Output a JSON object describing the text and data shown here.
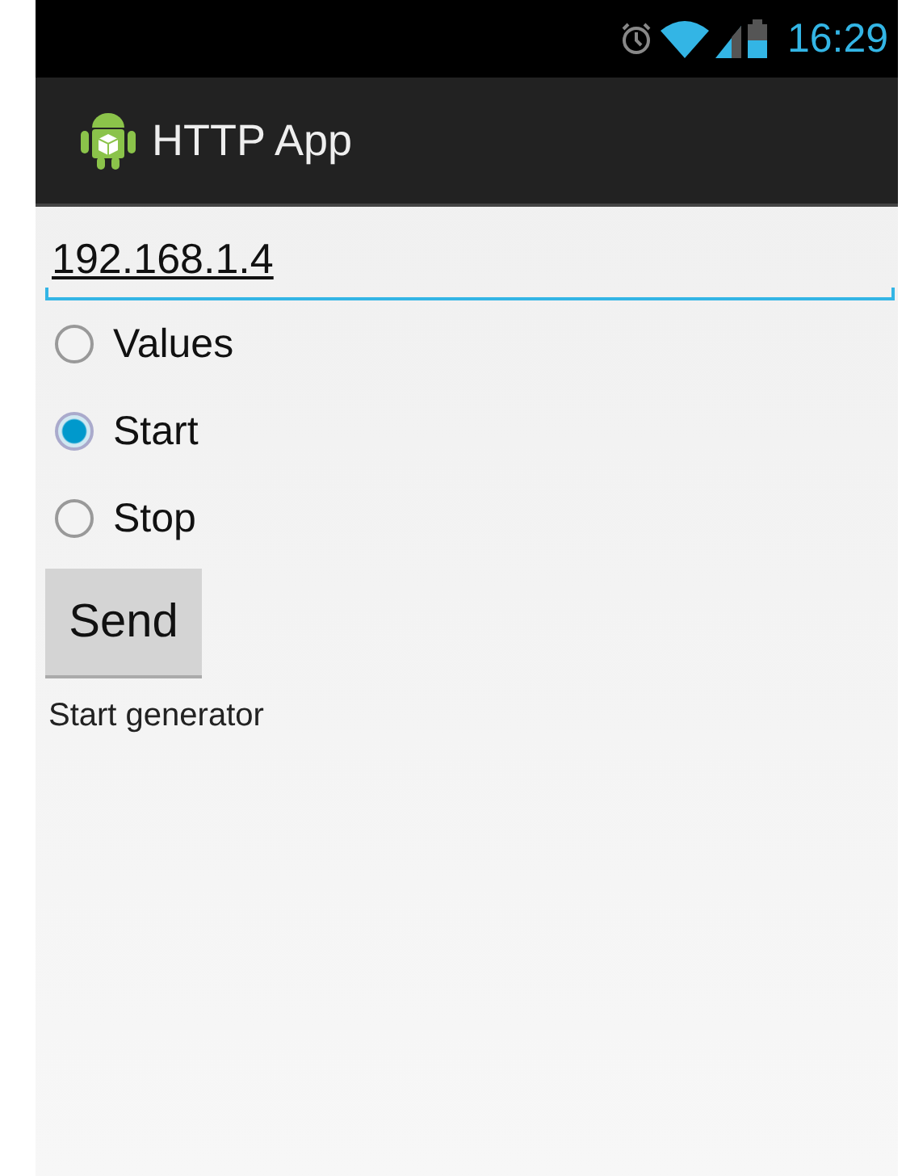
{
  "status_bar": {
    "time": "16:29"
  },
  "action_bar": {
    "title": "HTTP App"
  },
  "address_field": {
    "value": "192.168.1.4"
  },
  "options": [
    {
      "label": "Values",
      "selected": false
    },
    {
      "label": "Start",
      "selected": true
    },
    {
      "label": "Stop",
      "selected": false
    }
  ],
  "send_button": {
    "label": "Send"
  },
  "result": "Start generator"
}
